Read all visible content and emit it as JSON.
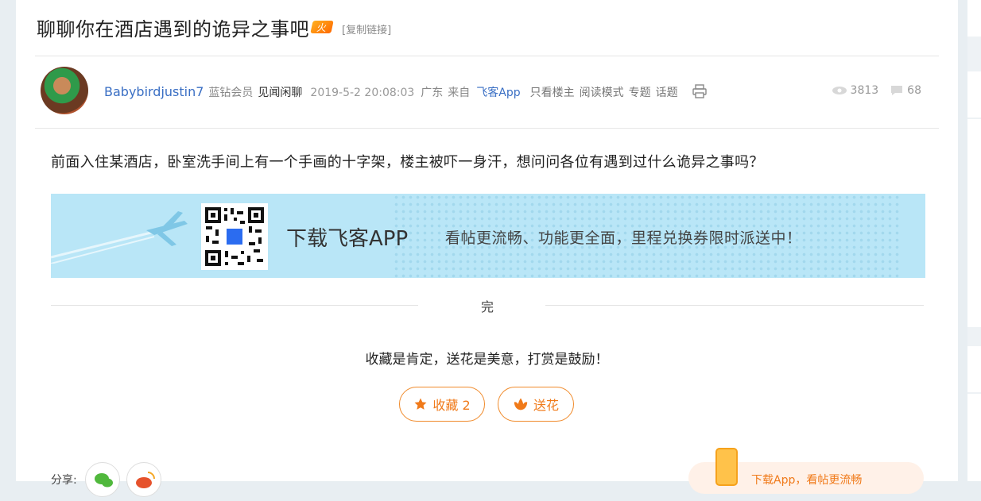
{
  "post": {
    "title": "聊聊你在酒店遇到的诡异之事吧",
    "hot_badge": "火",
    "copy_link": "[复制链接]",
    "author": {
      "name": "Babybirdjustin7",
      "level": "蓝钻会员",
      "tag": "见闻闲聊"
    },
    "date": "2019-5-2 20:08:03",
    "location": "广东",
    "from_label": "来自",
    "app_name": "飞客App",
    "menu": [
      "只看楼主",
      "阅读模式",
      "专题",
      "话题"
    ],
    "views": "3813",
    "replies": "68",
    "content": "前面入住某酒店，卧室洗手间上有一个手画的十字架，楼主被吓一身汗，想问问各位有遇到过什么诡异之事吗？",
    "end_mark": "完",
    "encourage": "收藏是肯定，送花是美意，打赏是鼓励！",
    "buttons": {
      "favorite": "收藏 2",
      "flower": "送花"
    },
    "share_label": "分享:"
  },
  "banner": {
    "headline": "下载飞客APP",
    "subline": "看帖更流畅、功能更全面，里程兑换券限时派送中！"
  },
  "app_promo": {
    "text": "下载App，看帖更流畅"
  },
  "colors": {
    "accent": "#f07a1a",
    "link": "#3a6fc4",
    "banner_bg": "#b9e6f7"
  }
}
